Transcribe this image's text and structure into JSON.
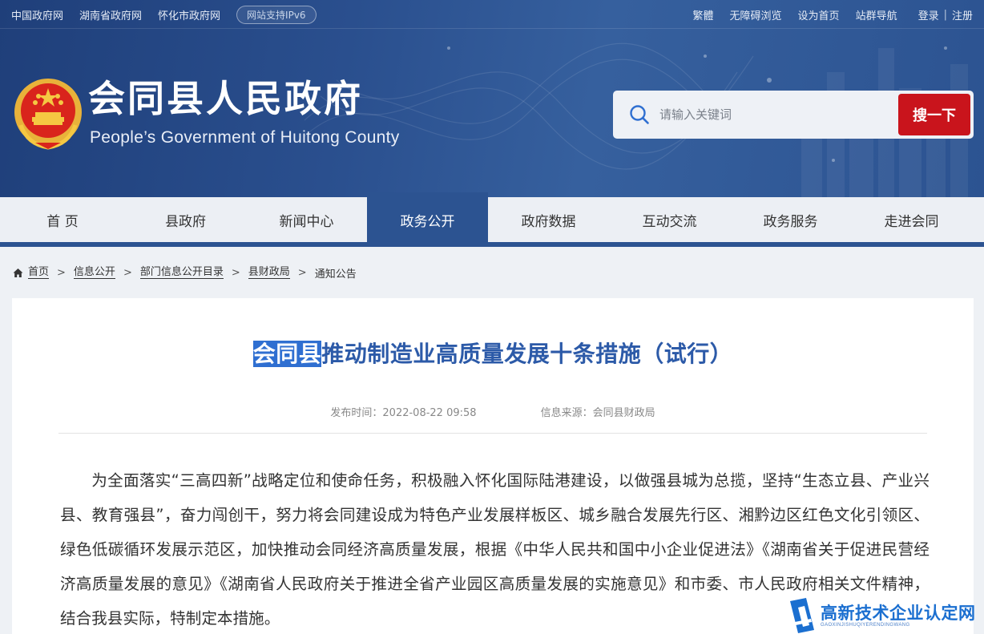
{
  "topbar": {
    "links": [
      "中国政府网",
      "湖南省政府网",
      "怀化市政府网"
    ],
    "ipv6_badge": "网站支持IPv6",
    "right_links": [
      "繁體",
      "无障碍浏览",
      "设为首页",
      "站群导航"
    ],
    "login": "登录",
    "separator": "|",
    "register": "注册"
  },
  "header": {
    "title": "会同县人民政府",
    "subtitle": "People’s Government of Huitong County"
  },
  "search": {
    "placeholder": "请输入关键词",
    "button_label": "搜一下"
  },
  "nav": {
    "items": [
      "首 页",
      "县政府",
      "新闻中心",
      "政务公开",
      "政府数据",
      "互动交流",
      "政务服务",
      "走进会同"
    ],
    "active_index": 3
  },
  "breadcrumb": {
    "items": [
      "首页",
      "信息公开",
      "部门信息公开目录",
      "县财政局"
    ],
    "current": "通知公告",
    "separator": ">"
  },
  "article": {
    "title_highlight": "会同县",
    "title_rest": "推动制造业高质量发展十条措施（试行）",
    "publish_time": "发布时间：2022-08-22 09:58",
    "source": "信息来源：会同县财政局",
    "body": "为全面落实“三高四新”战略定位和使命任务，积极融入怀化国际陆港建设，以做强县城为总揽，坚持“生态立县、产业兴县、教育强县”，奋力闯创干，努力将会同建设成为特色产业发展样板区、城乡融合发展先行区、湘黔边区红色文化引领区、绿色低碳循环发展示范区，加快推动会同经济高质量发展，根据《中华人民共和国中小企业促进法》《湖南省关于促进民营经济高质量发展的意见》《湖南省人民政府关于推进全省产业园区高质量发展的实施意见》和市委、市人民政府相关文件精神，结合我县实际，特制定本措施。"
  },
  "watermark": {
    "name": "高新技术企业认定网",
    "pinyin": "GAOXINJISHUQIYERENDINGWANG"
  },
  "colors": {
    "header_blue": "#2c5391",
    "search_button_red": "#c9141c",
    "title_blue": "#2c5aa8",
    "highlight_blue": "#2f6fd1"
  }
}
